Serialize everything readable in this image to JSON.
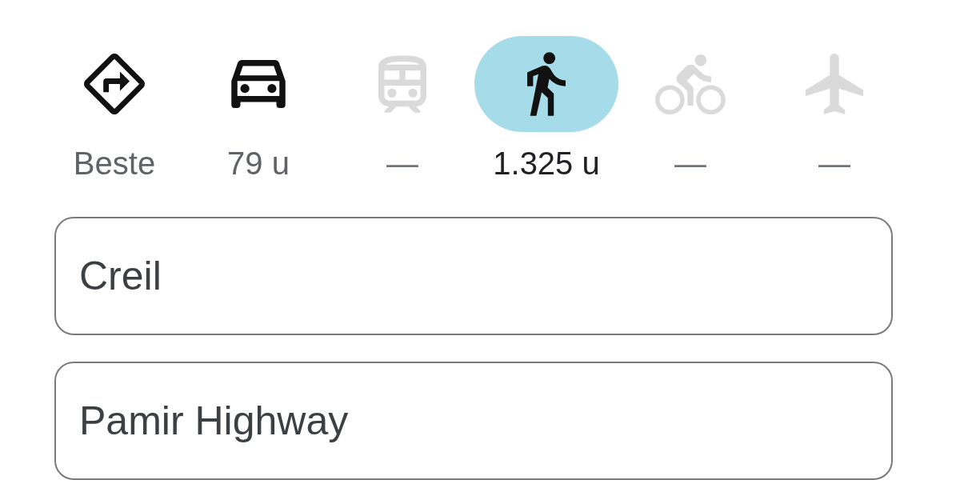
{
  "travel_modes": [
    {
      "kind": "best",
      "label": "Beste",
      "selected": false,
      "disabled": false
    },
    {
      "kind": "car",
      "label": "79 u",
      "selected": false,
      "disabled": false
    },
    {
      "kind": "transit",
      "label": "—",
      "selected": false,
      "disabled": true
    },
    {
      "kind": "walk",
      "label": "1.325 u",
      "selected": true,
      "disabled": false
    },
    {
      "kind": "bike",
      "label": "—",
      "selected": false,
      "disabled": true
    },
    {
      "kind": "flight",
      "label": "—",
      "selected": false,
      "disabled": true
    }
  ],
  "route_fields": [
    {
      "value": "Creil"
    },
    {
      "value": "Pamir Highway"
    }
  ]
}
